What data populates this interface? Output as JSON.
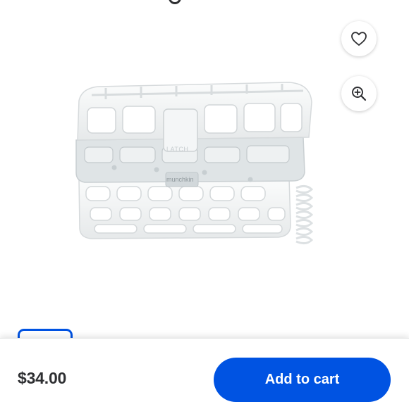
{
  "product": {
    "image_alt": "Dishwasher basket",
    "brand_embossed": "munchkin",
    "latch_embossed": "LATCH"
  },
  "actions": {
    "favorite_icon": "heart-icon",
    "zoom_icon": "zoom-in-icon"
  },
  "footer": {
    "price": "$34.00",
    "add_to_cart_label": "Add to cart"
  },
  "colors": {
    "accent": "#0053e2",
    "text": "#2e2f32"
  }
}
